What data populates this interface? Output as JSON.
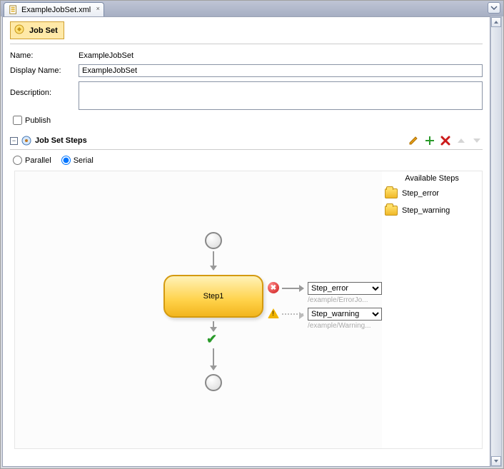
{
  "tab": {
    "filename": "ExampleJobSet.xml"
  },
  "section": {
    "title": "Job Set"
  },
  "form": {
    "name_label": "Name:",
    "name_value": "ExampleJobSet",
    "displayname_label": "Display Name:",
    "displayname_value": "ExampleJobSet",
    "description_label": "Description:",
    "description_value": "",
    "publish_label": "Publish",
    "publish_checked": false
  },
  "steps": {
    "title": "Job Set Steps",
    "mode": {
      "parallel_label": "Parallel",
      "serial_label": "Serial",
      "selected": "serial"
    }
  },
  "diagram": {
    "step_label": "Step1",
    "error_select": "Step_error",
    "error_path": "/example/ErrorJo...",
    "warning_select": "Step_warning",
    "warning_path": "/example/Warning..."
  },
  "available": {
    "title": "Available Steps",
    "items": [
      "Step_error",
      "Step_warning"
    ]
  }
}
